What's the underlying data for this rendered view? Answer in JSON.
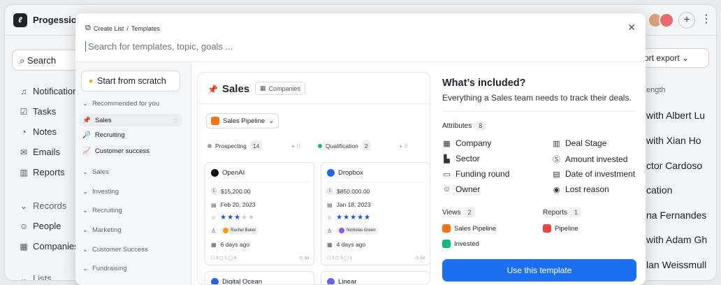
{
  "app": {
    "name": "Progession.io",
    "logo_letter": "ℓ"
  },
  "sidebar": {
    "search_label": "Search",
    "items": [
      {
        "label": "Notifications",
        "icon": "bell-icon"
      },
      {
        "label": "Tasks",
        "icon": "checkbox-icon"
      },
      {
        "label": "Notes",
        "icon": "note-icon"
      },
      {
        "label": "Emails",
        "icon": "mail-icon"
      },
      {
        "label": "Reports",
        "icon": "chart-icon"
      },
      {
        "label": "Records",
        "icon": "chevron-down-icon"
      },
      {
        "label": "People",
        "icon": "people-icon"
      },
      {
        "label": "Companies",
        "icon": "building-icon"
      },
      {
        "label": "Lists",
        "icon": "chevron-down-icon"
      }
    ]
  },
  "background_right": {
    "export_label": "ort export",
    "column_header": "ength",
    "rows": [
      "with Albert Lu",
      "with Xian Ho",
      "ctor Cardoso",
      "cation",
      "na Fernandes",
      "with Adam Gh",
      "lan Weissmull"
    ]
  },
  "modal": {
    "breadcrumb": {
      "root": "Create List",
      "separator": "/",
      "current": "Templates"
    },
    "search_placeholder": "Search for templates, topic, goals ...",
    "left": {
      "start_from_scratch": "Start from scratch",
      "recommended_label": "Recommended for you",
      "recommended_items": [
        {
          "label": "Sales",
          "icon": "pin-icon"
        },
        {
          "label": "Recruiting",
          "icon": "magnifier-icon"
        },
        {
          "label": "Customer success",
          "icon": "chart-up-icon"
        }
      ],
      "sections": [
        "Sales",
        "Investing",
        "Recruiting",
        "Marketing",
        "Customer Success",
        "Fundraising"
      ]
    },
    "preview": {
      "title": "Sales",
      "badge": "Companies",
      "pipeline_select": "Sales Pipeline",
      "columns": [
        {
          "name": "Prospecting",
          "count": "14",
          "color": "#9ca3af"
        },
        {
          "name": "Qualification",
          "count": "2",
          "color": "#10b981"
        }
      ],
      "cards": [
        {
          "name": "OpenAI",
          "logo_color": "#111111",
          "amount": "$15,200.00",
          "date": "Feb 20, 2023",
          "stars": 3,
          "person": "Rachel Baker",
          "person_color": "#f59e0b",
          "days": "6 days ago",
          "footer": "☐ 3  ▢ 1  ◯ 4",
          "footer_right": "3d"
        },
        {
          "name": "Dropbox",
          "logo_color": "#2563eb",
          "amount": "$850,000.00",
          "date": "Jan 18, 2023",
          "stars": 5,
          "person": "Nicholas Green",
          "person_color": "#8b5cf6",
          "days": "4 days ago",
          "footer": "☐ 3  ▢ 5  ◯ 1",
          "footer_right": "5d"
        },
        {
          "name": "Digital Ocean",
          "logo_color": "#2563eb"
        },
        {
          "name": "Linear",
          "logo_color": "#6366f1"
        }
      ]
    },
    "included": {
      "title": "What’s included?",
      "description": "Everything a Sales team needs to track their deals.",
      "attributes_label": "Attributes",
      "attributes_count": "8",
      "attributes": [
        {
          "label": "Company",
          "icon": "building-icon"
        },
        {
          "label": "Deal Stage",
          "icon": "bars-icon"
        },
        {
          "label": "Sector",
          "icon": "sector-icon"
        },
        {
          "label": "Amount invested",
          "icon": "dollar-icon"
        },
        {
          "label": "Funding round",
          "icon": "card-icon"
        },
        {
          "label": "Date of investment",
          "icon": "calendar-icon"
        },
        {
          "label": "Owner",
          "icon": "user-icon"
        },
        {
          "label": "Lost reason",
          "icon": "target-icon"
        }
      ],
      "views_label": "Views",
      "views_count": "2",
      "views": [
        {
          "label": "Sales Pipeline",
          "color": "#f97316"
        },
        {
          "label": "Invested",
          "color": "#10b981"
        }
      ],
      "reports_label": "Reports",
      "reports_count": "1",
      "reports": [
        {
          "label": "Pipeline",
          "color": "#ef4444"
        }
      ],
      "use_button": "Use this template"
    }
  }
}
